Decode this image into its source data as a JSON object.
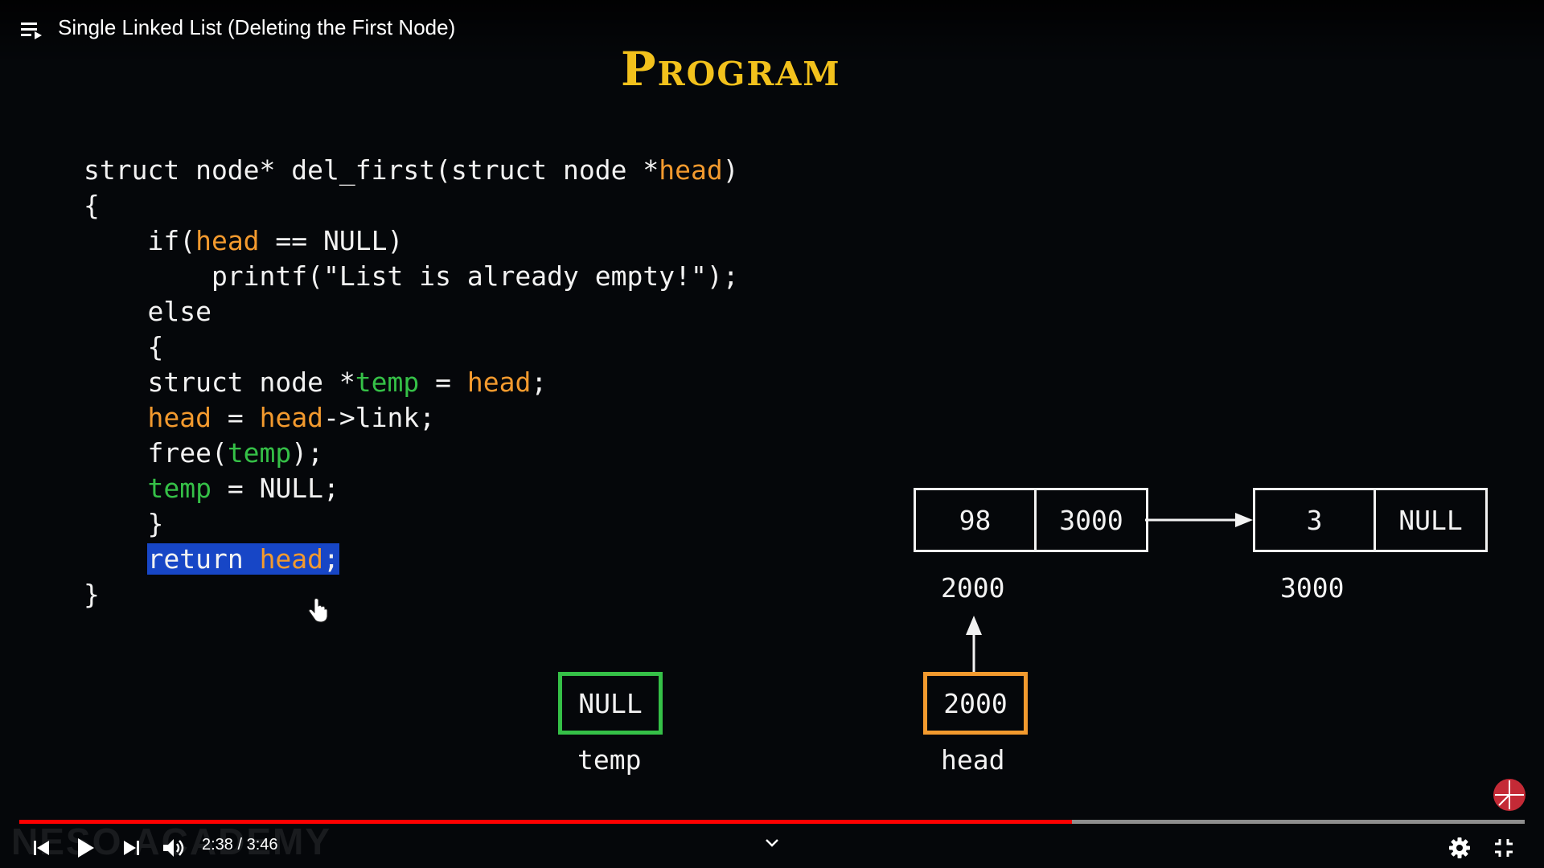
{
  "player": {
    "video_title": "Single Linked List (Deleting the First Node)",
    "current_time": "2:38",
    "duration": "3:46",
    "time_display": "2:38 / 3:46",
    "progress_fraction": 0.699,
    "watermark": "NESO ACADEMY",
    "colors": {
      "progress": "#ff0000",
      "track": "#8e8e8e"
    },
    "icons": [
      "playlist-icon",
      "previous-icon",
      "play-icon",
      "next-icon",
      "volume-icon",
      "chevron-down-icon",
      "settings-icon",
      "exit-fullscreen-icon"
    ]
  },
  "slide": {
    "title": "Program",
    "colors": {
      "orange": "#f39a2e",
      "green": "#35c047",
      "highlight": "#1746c6",
      "title": "#f2c11c"
    },
    "code_lines": [
      [
        {
          "t": "struct node* del_first(struct node *"
        },
        {
          "t": "head",
          "c": "orange"
        },
        {
          "t": ")"
        }
      ],
      [
        {
          "t": "{"
        }
      ],
      [
        {
          "t": "    if("
        },
        {
          "t": "head",
          "c": "orange"
        },
        {
          "t": " == NULL)"
        }
      ],
      [
        {
          "t": "        printf(\"List is already empty!\");"
        }
      ],
      [
        {
          "t": "    else"
        }
      ],
      [
        {
          "t": "    {"
        }
      ],
      [
        {
          "t": "    struct node *"
        },
        {
          "t": "temp",
          "c": "green"
        },
        {
          "t": " = "
        },
        {
          "t": "head",
          "c": "orange"
        },
        {
          "t": ";"
        }
      ],
      [
        {
          "t": "    "
        },
        {
          "t": "head",
          "c": "orange"
        },
        {
          "t": " = "
        },
        {
          "t": "head",
          "c": "orange"
        },
        {
          "t": "->link;"
        }
      ],
      [
        {
          "t": "    free("
        },
        {
          "t": "temp",
          "c": "green"
        },
        {
          "t": ");"
        }
      ],
      [
        {
          "t": "    "
        },
        {
          "t": "temp",
          "c": "green"
        },
        {
          "t": " = NULL;"
        }
      ],
      [
        {
          "t": "    }"
        }
      ],
      [
        {
          "t": "    "
        },
        {
          "t": "return ",
          "hl": true
        },
        {
          "t": "head",
          "c": "orange",
          "hl": true
        },
        {
          "t": ";",
          "hl": true
        }
      ],
      [
        {
          "t": "}"
        }
      ]
    ],
    "diagram": {
      "node1": {
        "data": "98",
        "link": "3000",
        "address": "2000"
      },
      "node2": {
        "data": "3",
        "link": "NULL",
        "address": "3000"
      },
      "temp": {
        "value": "NULL",
        "label": "temp"
      },
      "head": {
        "value": "2000",
        "label": "head"
      }
    }
  }
}
